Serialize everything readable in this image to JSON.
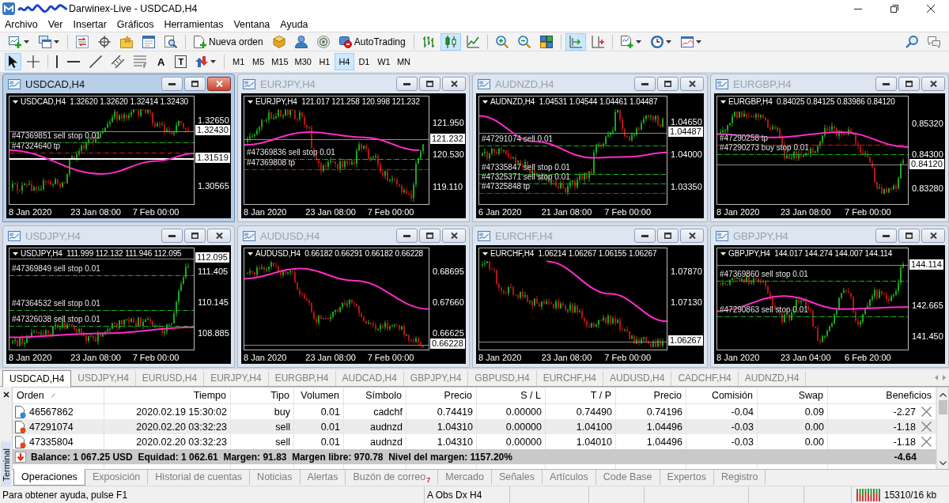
{
  "window": {
    "title": "Darwinex-Live - USDCAD,H4"
  },
  "menu": [
    "Archivo",
    "Ver",
    "Insertar",
    "Gráficos",
    "Herramientas",
    "Ventana",
    "Ayuda"
  ],
  "toolbar": [
    {
      "kind": "tool",
      "dropdown": true,
      "selected": false
    },
    {
      "kind": "tool",
      "dropdown": true,
      "selected": false
    },
    {
      "kind": "separator"
    },
    {
      "kind": "tool",
      "selected": false
    },
    {
      "kind": "tool",
      "selected": false
    },
    {
      "kind": "tool",
      "selected": false
    },
    {
      "kind": "tool",
      "selected": false
    },
    {
      "kind": "tool",
      "selected": false
    },
    {
      "kind": "separator"
    },
    {
      "kind": "labeled",
      "label": "Nueva orden",
      "selected": false
    },
    {
      "kind": "tool",
      "selected": false
    },
    {
      "kind": "tool",
      "selected": false
    },
    {
      "kind": "tool",
      "selected": false
    },
    {
      "kind": "labeled",
      "label": "AutoTrading",
      "selected": false
    },
    {
      "kind": "separator"
    },
    {
      "kind": "tool",
      "selected": false
    },
    {
      "kind": "tool",
      "selected": true
    },
    {
      "kind": "tool",
      "selected": false
    },
    {
      "kind": "separator"
    },
    {
      "kind": "tool",
      "selected": false
    },
    {
      "kind": "tool",
      "selected": false
    },
    {
      "kind": "tool",
      "selected": false
    },
    {
      "kind": "separator"
    },
    {
      "kind": "tool",
      "selected": true
    },
    {
      "kind": "tool",
      "selected": false
    },
    {
      "kind": "separator"
    },
    {
      "kind": "tool",
      "dropdown": true,
      "selected": false
    },
    {
      "kind": "tool",
      "dropdown": true,
      "selected": false
    },
    {
      "kind": "tool",
      "dropdown": true,
      "selected": false
    }
  ],
  "toolbar_right": [
    {
      "kind": "tool",
      "selected": false
    },
    {
      "kind": "tool",
      "selected": false
    }
  ],
  "drawing_tools": [
    {
      "kind": "tool",
      "selected": true
    },
    {
      "kind": "tool",
      "selected": false
    },
    {
      "kind": "separator"
    },
    {
      "kind": "tool",
      "selected": false
    },
    {
      "kind": "tool",
      "selected": false
    },
    {
      "kind": "tool",
      "selected": false
    },
    {
      "kind": "tool",
      "selected": false
    },
    {
      "kind": "tool",
      "selected": false
    },
    {
      "kind": "glyph",
      "label": "A",
      "selected": false
    },
    {
      "kind": "framed-glyph",
      "label": "T",
      "selected": false
    },
    {
      "kind": "tool",
      "dropdown": true,
      "selected": false
    },
    {
      "kind": "separator"
    }
  ],
  "timeframes": [
    {
      "label": "M1",
      "selected": false
    },
    {
      "label": "M5",
      "selected": false
    },
    {
      "label": "M15",
      "selected": false
    },
    {
      "label": "M30",
      "selected": false
    },
    {
      "label": "H1",
      "selected": false
    },
    {
      "label": "H4",
      "selected": true
    },
    {
      "label": "D1",
      "selected": false
    },
    {
      "label": "W1",
      "selected": false
    },
    {
      "label": "MN",
      "selected": false
    }
  ],
  "charts": [
    {
      "title": "USDCAD,H4",
      "selected": true,
      "header": "USDCAD,H4  1.32620 1.32620 1.32414 1.32430",
      "axis": [
        {
          "text": "1.32650",
          "kind": "tick"
        },
        {
          "text": "1.32430",
          "kind": "bid"
        },
        {
          "text": "1.31519",
          "kind": "hline"
        },
        {
          "text": "1.30565",
          "kind": "tick"
        }
      ],
      "dates": [
        "8 Jan 2020",
        "23 Jan 08:00",
        "7 Feb 00:00"
      ],
      "orders": [
        {
          "text": "#47369851 sell stop 0.01",
          "kind": "entry"
        },
        {
          "text": "#47324640 tp",
          "kind": "tp"
        }
      ]
    },
    {
      "title": "EURJPY,H4",
      "selected": false,
      "header": "EURJPY,H4  121.017 121.258 120.998 121.232",
      "axis": [
        {
          "text": "121.950",
          "kind": "tick"
        },
        {
          "text": "121.232",
          "kind": "bid"
        },
        {
          "text": "120.530",
          "kind": "tick"
        },
        {
          "text": "119.110",
          "kind": "tick"
        }
      ],
      "dates": [
        "8 Jan 2020",
        "23 Jan 08:00",
        "7 Feb 00:00"
      ],
      "orders": [
        {
          "text": "#47369836 sell stop 0.01",
          "kind": "entry"
        },
        {
          "text": "#47369808 tp",
          "kind": "tp"
        }
      ]
    },
    {
      "title": "AUDNZD,H4",
      "selected": false,
      "header": "AUDNZD,H4  1.04531 1.04544 1.04461 1.04487",
      "axis": [
        {
          "text": "1.04650",
          "kind": "tick"
        },
        {
          "text": "1.04487",
          "kind": "bid"
        },
        {
          "text": "1.04000",
          "kind": "tick"
        },
        {
          "text": "1.03350",
          "kind": "tick"
        }
      ],
      "dates": [
        "6 Jan 2020",
        "21 Jan 08:00",
        "7 Feb 00:00"
      ],
      "orders": [
        {
          "text": "#47291074 sell 0.01",
          "kind": "entry"
        },
        {
          "text": "#47335847 sell stop 0.01",
          "kind": "entry"
        },
        {
          "text": "#47325371 sell stop 0.01",
          "kind": "entry"
        },
        {
          "text": "#47325848 tp",
          "kind": "tp"
        }
      ]
    },
    {
      "title": "EURGBP,H4",
      "selected": false,
      "header": "EURGBP,H4  0.84025 0.84125 0.83986 0.84120",
      "axis": [
        {
          "text": "0.85320",
          "kind": "tick"
        },
        {
          "text": "0.84300",
          "kind": "tick"
        },
        {
          "text": "0.84120",
          "kind": "bid"
        },
        {
          "text": "0.83280",
          "kind": "tick"
        }
      ],
      "dates": [
        "8 Jan 2020",
        "23 Jan 08:00",
        "7 Feb 00:00"
      ],
      "orders": [
        {
          "text": "#47290258 tp",
          "kind": "tp"
        },
        {
          "text": "#47290273 buy stop 0.01",
          "kind": "entry"
        }
      ]
    },
    {
      "title": "USDJPY,H4",
      "selected": false,
      "header": "USDJPY,H4  111.999 112.132 111.946 112.095",
      "axis": [
        {
          "text": "112.095",
          "kind": "bid"
        },
        {
          "text": "111.405",
          "kind": "tick"
        },
        {
          "text": "110.145",
          "kind": "tick"
        },
        {
          "text": "108.885",
          "kind": "tick"
        }
      ],
      "dates": [
        "8 Jan 2020",
        "23 Jan 08:00",
        "7 Feb 00:00"
      ],
      "orders": [
        {
          "text": "#47369849 sell stop 0.01",
          "kind": "entry"
        },
        {
          "text": "#47364532 sell stop 0.01",
          "kind": "entry"
        },
        {
          "text": "#47326038 sell stop 0.01",
          "kind": "entry"
        }
      ]
    },
    {
      "title": "AUDUSD,H4",
      "selected": false,
      "header": "AUDUSD,H4  0.66182 0.66291 0.66182 0.66228",
      "axis": [
        {
          "text": "0.68695",
          "kind": "tick"
        },
        {
          "text": "0.67660",
          "kind": "tick"
        },
        {
          "text": "0.66625",
          "kind": "tick"
        },
        {
          "text": "0.66228",
          "kind": "bid"
        }
      ],
      "dates": [
        "8 Jan 2020",
        "23 Jan 08:00",
        "7 Feb 00:00"
      ]
    },
    {
      "title": "EURCHF,H4",
      "selected": false,
      "header": "EURCHF,H4  1.06214 1.06267 1.06155 1.06267",
      "axis": [
        {
          "text": "1.07870",
          "kind": "tick"
        },
        {
          "text": "1.07130",
          "kind": "tick"
        },
        {
          "text": "1.06267",
          "kind": "bid"
        }
      ],
      "dates": [
        "8 Jan 2020",
        "23 Jan 08:00",
        "7 Feb 00:00"
      ]
    },
    {
      "title": "GBPJPY,H4",
      "selected": false,
      "header": "GBPJPY,H4  144.017 144.274 144.007 144.114",
      "axis": [
        {
          "text": "144.114",
          "kind": "bid"
        },
        {
          "text": "142.665",
          "kind": "tick"
        },
        {
          "text": "141.450",
          "kind": "tick"
        }
      ],
      "dates": [
        "8 Jan 2020",
        "23 Jan 04:00",
        "6 Feb 20:00"
      ],
      "orders": [
        {
          "text": "#47369860 sell stop 0.01",
          "kind": "entry"
        },
        {
          "text": "#47290863 sell stop 0.01",
          "kind": "entry"
        }
      ]
    }
  ],
  "chart_tabs": [
    {
      "label": "USDCAD,H4",
      "selected": true
    },
    {
      "label": "USDJPY,H4",
      "selected": false
    },
    {
      "label": "EURUSD,H4",
      "selected": false
    },
    {
      "label": "EURJPY,H4",
      "selected": false
    },
    {
      "label": "EURGBP,H4",
      "selected": false
    },
    {
      "label": "AUDCAD,H4",
      "selected": false
    },
    {
      "label": "GBPJPY,H4",
      "selected": false
    },
    {
      "label": "GBPUSD,H4",
      "selected": false
    },
    {
      "label": "EURCHF,H4",
      "selected": false
    },
    {
      "label": "AUDUSD,H4",
      "selected": false
    },
    {
      "label": "CADCHF,H4",
      "selected": false
    },
    {
      "label": "AUDNZD,H4",
      "selected": false
    }
  ],
  "terminal": {
    "title": "Terminal",
    "columns": [
      {
        "label": "Orden",
        "sorted": true
      },
      {
        "label": "Tiempo",
        "sorted": false
      },
      {
        "label": "Tipo",
        "sorted": false
      },
      {
        "label": "Volumen",
        "sorted": false
      },
      {
        "label": "Símbolo",
        "sorted": false
      },
      {
        "label": "Precio",
        "sorted": false
      },
      {
        "label": "S / L",
        "sorted": false
      },
      {
        "label": "T / P",
        "sorted": false
      },
      {
        "label": "Precio",
        "sorted": false
      },
      {
        "label": "Comisión",
        "sorted": false
      },
      {
        "label": "Swap",
        "sorted": false
      },
      {
        "label": "Beneficios",
        "sorted": false
      }
    ],
    "rows": [
      {
        "color": "#2a88dc",
        "selected": false,
        "cells": [
          "46567862",
          "2020.02.19 15:30:02",
          "buy",
          "0.01",
          "cadchf",
          "0.74419",
          "0.00000",
          "0.74490",
          "0.74196",
          "-0.04",
          "0.09",
          "-2.27"
        ]
      },
      {
        "color": "#e2481e",
        "selected": false,
        "cells": [
          "47291074",
          "2020.02.20 03:32:23",
          "sell",
          "0.01",
          "audnzd",
          "1.04310",
          "0.00000",
          "1.04100",
          "1.04496",
          "-0.03",
          "0.00",
          "-1.18"
        ]
      },
      {
        "color": "#e2481e",
        "selected": false,
        "cells": [
          "47335804",
          "2020.02.20 03:32:23",
          "sell",
          "0.01",
          "audnzd",
          "1.04310",
          "0.00000",
          "1.04010",
          "1.04496",
          "-0.03",
          "0.00",
          "-1.18"
        ]
      }
    ],
    "summary": {
      "text": "Balance: 1 067.25 USD  Equidad: 1 062.61  Margen: 91.83  Margen libre: 970.78  Nivel del margen: 1157.20%",
      "profit": "-4.64"
    },
    "tabs": [
      {
        "label": "Operaciones",
        "selected": true
      },
      {
        "label": "Exposición",
        "selected": false
      },
      {
        "label": "Historial de cuentas",
        "selected": false
      },
      {
        "label": "Noticias",
        "selected": false
      },
      {
        "label": "Alertas",
        "selected": false
      },
      {
        "label": "Buzón de correo",
        "badge": "7",
        "selected": false
      },
      {
        "label": "Mercado",
        "selected": false
      },
      {
        "label": "Señales",
        "selected": false
      },
      {
        "label": "Artículos",
        "selected": false
      },
      {
        "label": "Code Base",
        "selected": false
      },
      {
        "label": "Expertos",
        "selected": false
      },
      {
        "label": "Registro",
        "selected": false
      }
    ]
  },
  "status_bar": {
    "help_text": "Para obtener ayuda, pulse F1",
    "section_2": "A Obs Dx H4",
    "connection": "15310/16 kb"
  }
}
